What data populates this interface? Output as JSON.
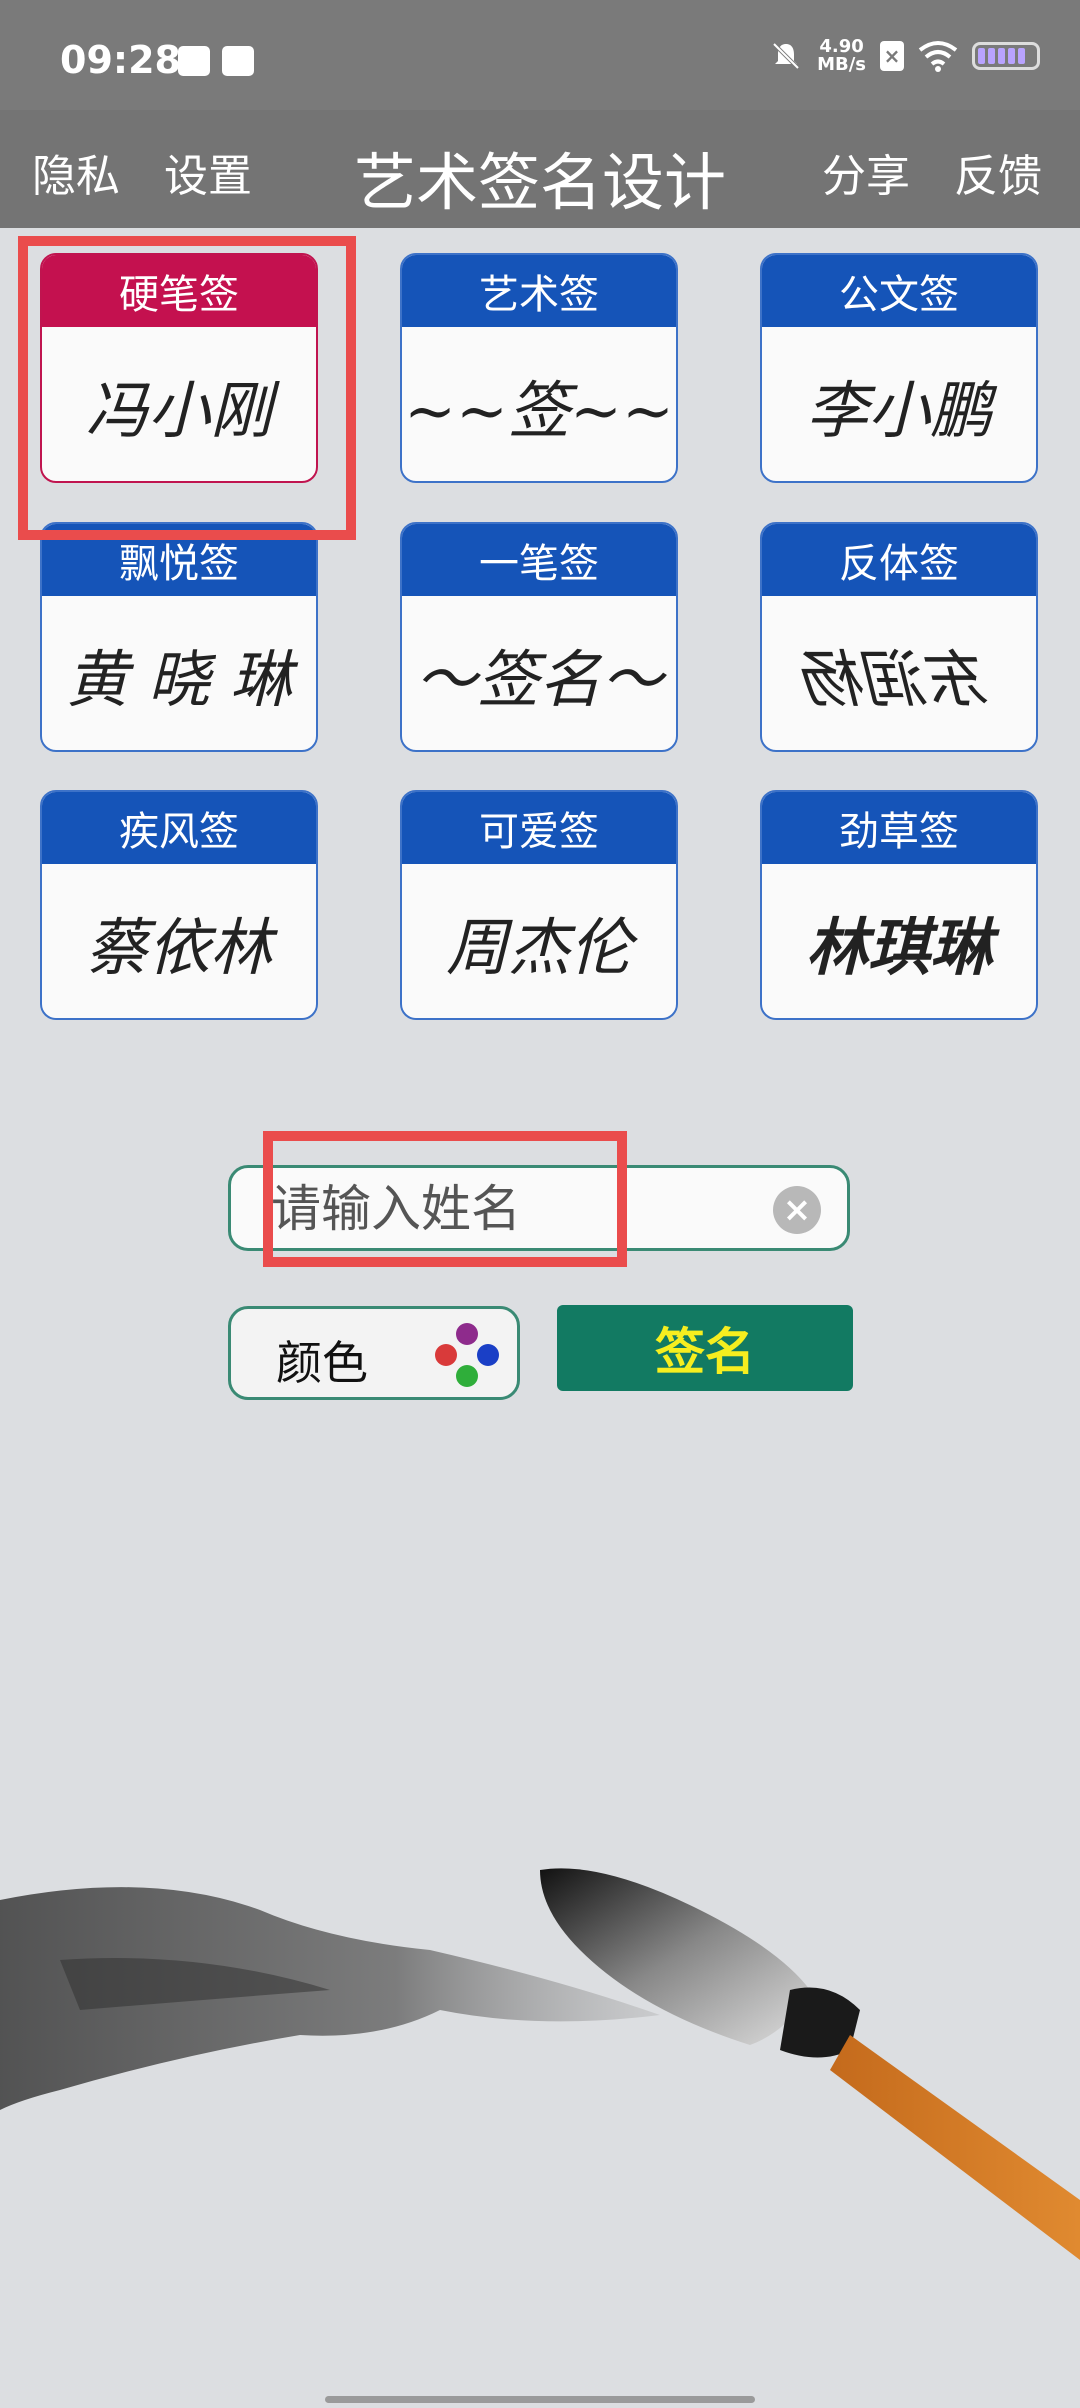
{
  "status_bar": {
    "time": "09:28",
    "net_speed_value": "4.90",
    "net_speed_unit": "MB/s",
    "icons": [
      "calendar-icon",
      "mail-icon",
      "mute-icon",
      "sim-icon",
      "wifi-icon",
      "battery-icon"
    ]
  },
  "app_bar": {
    "privacy": "隐私",
    "settings": "设置",
    "title": "艺术签名设计",
    "share": "分享",
    "feedback": "反馈"
  },
  "styles": [
    {
      "label": "硬笔签",
      "sample": "冯小刚",
      "active": true
    },
    {
      "label": "艺术签",
      "sample": "~~签~~"
    },
    {
      "label": "公文签",
      "sample": "李小鹏"
    },
    {
      "label": "飘悦签",
      "sample": "黄 晓 琳"
    },
    {
      "label": "一笔签",
      "sample": "～签名～"
    },
    {
      "label": "反体签",
      "sample": "东润杨"
    },
    {
      "label": "疾风签",
      "sample": "蔡依林"
    },
    {
      "label": "可爱签",
      "sample": "周杰伦"
    },
    {
      "label": "劲草签",
      "sample": "林琪琳"
    }
  ],
  "name_input": {
    "placeholder": "请输入姓名",
    "value": ""
  },
  "color_button": {
    "label": "颜色",
    "dot_colors": [
      "#8e2b8c",
      "#d93a3a",
      "#1a3fc6",
      "#2fae3a"
    ]
  },
  "sign_button": {
    "label": "签名"
  },
  "colors": {
    "active_header": "#c4114f",
    "header": "#1554b8",
    "sign_button_bg": "#127a62",
    "sign_button_text": "#f6ee1f",
    "highlight": "#ea4c4c"
  }
}
